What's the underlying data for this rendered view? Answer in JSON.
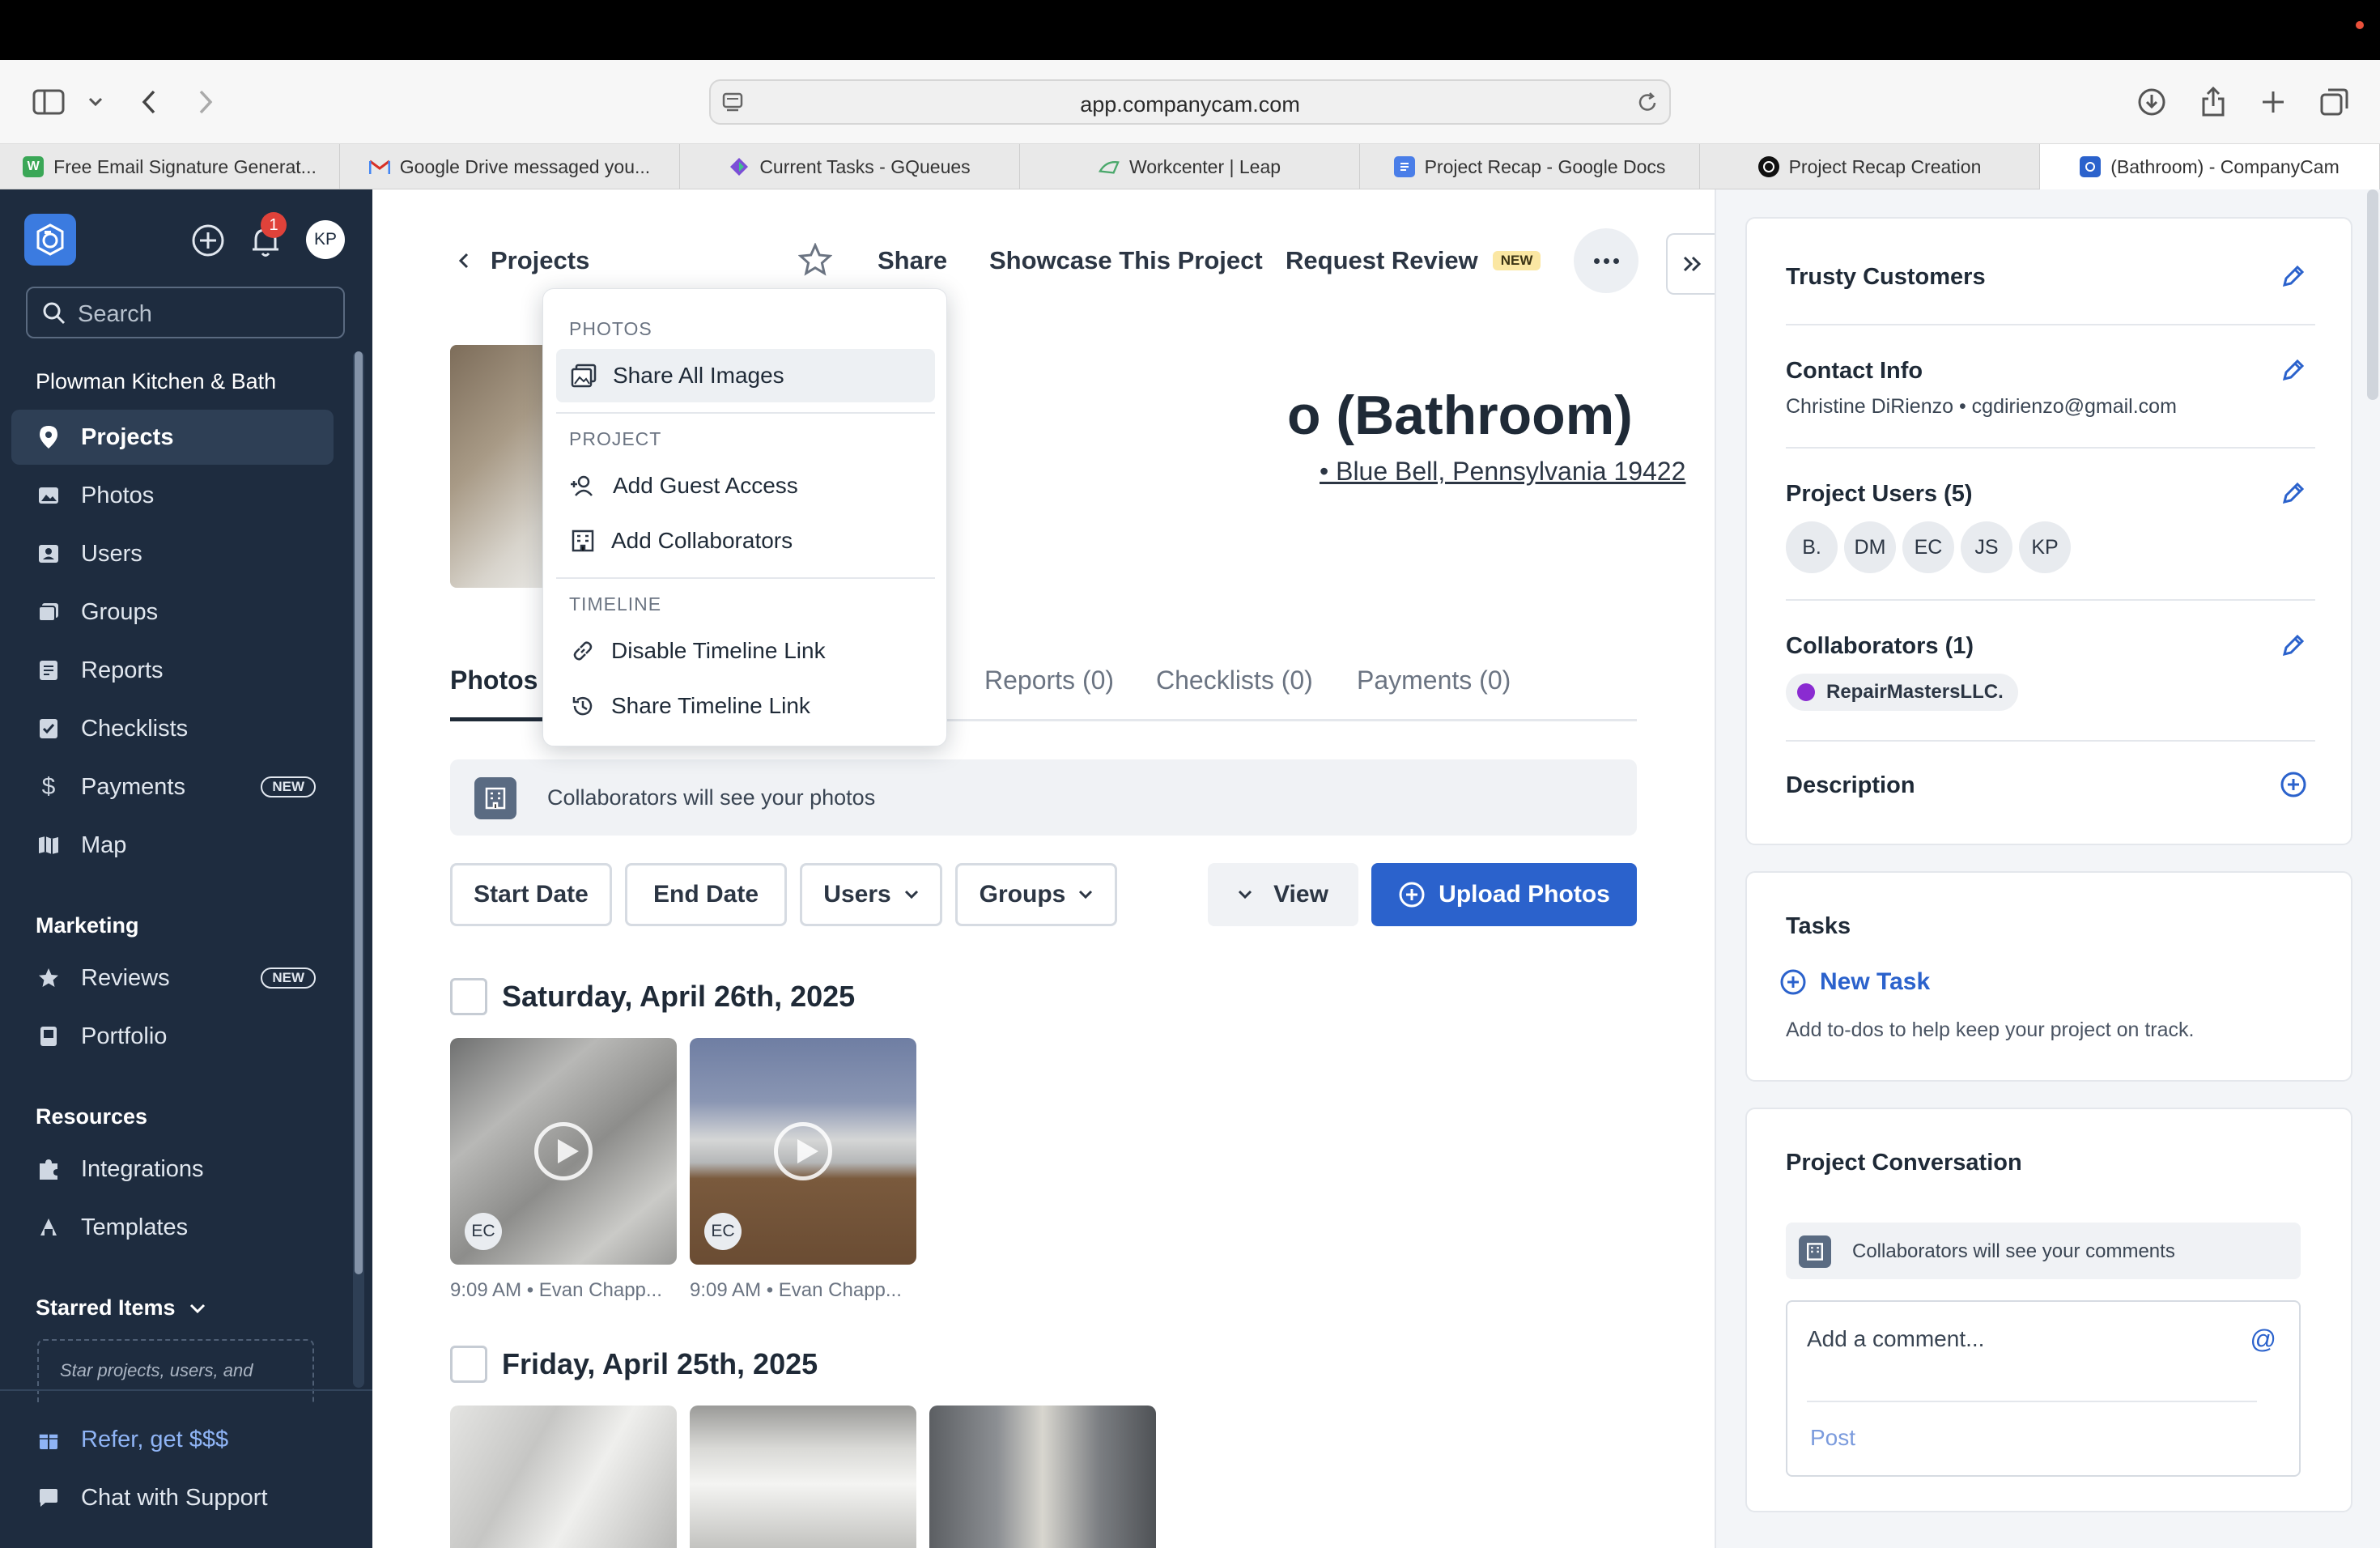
{
  "browser": {
    "url": "app.companycam.com",
    "tabs": [
      {
        "label": "Free Email Signature Generat...",
        "icon": "signature-icon"
      },
      {
        "label": "Google Drive messaged you...",
        "icon": "gmail-icon"
      },
      {
        "label": "Current Tasks - GQueues",
        "icon": "gqueues-icon"
      },
      {
        "label": "Workcenter | Leap",
        "icon": "leap-icon"
      },
      {
        "label": "Project Recap - Google Docs",
        "icon": "docs-icon"
      },
      {
        "label": "Project Recap Creation",
        "icon": "openai-icon"
      },
      {
        "label": "(Bathroom) - CompanyCam",
        "icon": "companycam-icon"
      }
    ]
  },
  "sidebar": {
    "notification_count": "1",
    "user_initials": "KP",
    "search_placeholder": "Search",
    "company": "Plowman Kitchen & Bath",
    "items": [
      {
        "label": "Projects",
        "icon": "map-pin-icon"
      },
      {
        "label": "Photos",
        "icon": "image-icon"
      },
      {
        "label": "Users",
        "icon": "user-card-icon"
      },
      {
        "label": "Groups",
        "icon": "groups-icon"
      },
      {
        "label": "Reports",
        "icon": "report-icon"
      },
      {
        "label": "Checklists",
        "icon": "checklist-icon"
      },
      {
        "label": "Payments",
        "icon": "dollar-icon",
        "badge": "NEW"
      },
      {
        "label": "Map",
        "icon": "map-icon"
      }
    ],
    "marketing_heading": "Marketing",
    "marketing_items": [
      {
        "label": "Reviews",
        "icon": "star-icon",
        "badge": "NEW"
      },
      {
        "label": "Portfolio",
        "icon": "portfolio-icon"
      }
    ],
    "resources_heading": "Resources",
    "resources_items": [
      {
        "label": "Integrations",
        "icon": "puzzle-icon"
      },
      {
        "label": "Templates",
        "icon": "templates-icon"
      }
    ],
    "starred_heading": "Starred Items",
    "starred_hint": "Star projects, users, and",
    "refer": "Refer, get $$$",
    "support": "Chat with Support"
  },
  "header": {
    "back_label": "Projects",
    "share": "Share",
    "showcase": "Showcase This Project",
    "request_review": "Request Review",
    "request_review_badge": "NEW"
  },
  "project": {
    "title_visible": "o (Bathroom)",
    "address_visible": "• Blue Bell, Pennsylvania 19422"
  },
  "tabs": {
    "photos": "Photos (",
    "reports": "Reports (0)",
    "checklists": "Checklists (0)",
    "payments": "Payments (0)"
  },
  "banner": "Collaborators will see your photos",
  "filters": {
    "start_date": "Start Date",
    "end_date": "End Date",
    "users": "Users",
    "groups": "Groups",
    "view": "View",
    "upload": "Upload Photos"
  },
  "days": [
    {
      "date": "Saturday, April 26th, 2025",
      "photos": [
        {
          "meta": "9:09 AM • Evan Chapp...",
          "initials": "EC",
          "video": true
        },
        {
          "meta": "9:09 AM • Evan Chapp...",
          "initials": "EC",
          "video": true
        }
      ]
    },
    {
      "date": "Friday, April 25th, 2025",
      "photos": []
    }
  ],
  "dropdown": {
    "photos_head": "PHOTOS",
    "share_all": "Share All Images",
    "project_head": "PROJECT",
    "guest_access": "Add Guest Access",
    "collaborators": "Add Collaborators",
    "timeline_head": "TIMELINE",
    "disable_timeline": "Disable Timeline Link",
    "share_timeline": "Share Timeline Link"
  },
  "right_panel": {
    "customer": "Trusty Customers",
    "contact_title": "Contact Info",
    "contact_value": "Christine DiRienzo • cgdirienzo@gmail.com",
    "users_title": "Project Users (5)",
    "users": [
      "B.",
      "DM",
      "EC",
      "JS",
      "KP"
    ],
    "collab_title": "Collaborators (1)",
    "collab_name": "RepairMastersLLC.",
    "description_title": "Description",
    "tasks_title": "Tasks",
    "new_task": "New Task",
    "tasks_hint": "Add to-dos to help keep your project on track.",
    "conversation_title": "Project Conversation",
    "conversation_banner": "Collaborators will see your comments",
    "comment_placeholder": "Add a comment...",
    "post": "Post"
  },
  "colors": {
    "sidebar_bg": "#1e2c3f",
    "accent_blue": "#2b62cc",
    "notification_red": "#e0423a",
    "collab_purple": "#8a2bd1"
  }
}
